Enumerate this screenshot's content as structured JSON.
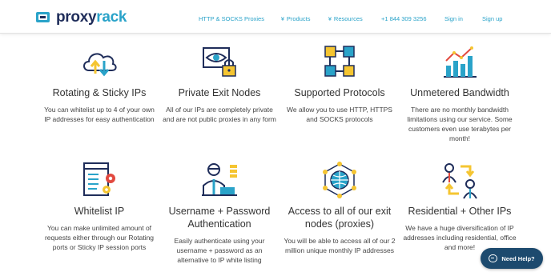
{
  "header": {
    "logo_part1": "proxy",
    "logo_part2": "rack",
    "nav": [
      {
        "label": "HTTP & SOCKS Proxies",
        "dropdown": false
      },
      {
        "label": "Products",
        "dropdown": true
      },
      {
        "label": "Resources",
        "dropdown": true
      },
      {
        "label": "+1 844 309 3256",
        "dropdown": false
      },
      {
        "label": "Sign in",
        "dropdown": false
      },
      {
        "label": "Sign up",
        "dropdown": false
      }
    ],
    "caret_glyph": "¥"
  },
  "features": [
    {
      "icon": "cloud-transfer-icon",
      "title": "Rotating & Sticky IPs",
      "description": "You can whitelist up to 4 of your own IP addresses for easy authentication"
    },
    {
      "icon": "eye-lock-icon",
      "title": "Private Exit Nodes",
      "description": "All of our IPs are completely private and are not public proxies in any form"
    },
    {
      "icon": "protocol-chain-icon",
      "title": "Supported Protocols",
      "description": "We allow you to use HTTP, HTTPS and SOCKS protocols"
    },
    {
      "icon": "bandwidth-chart-icon",
      "title": "Unmetered Bandwidth",
      "description": "There are no monthly bandwidth limitations using our service. Some customers even use terabytes per month!"
    },
    {
      "icon": "whitelist-browser-icon",
      "title": "Whitelist IP",
      "description": "You can make unlimited amount of requests either through our Rotating ports or Sticky IP session ports"
    },
    {
      "icon": "user-laptop-icon",
      "title": "Username + Password Authentication",
      "description": "Easily authenticate using your username + password as an alternative to IP white listing"
    },
    {
      "icon": "globe-network-icon",
      "title": "Access to all of our exit nodes (proxies)",
      "description": "You will be able to access all of our 2 million unique monthly IP addresses"
    },
    {
      "icon": "users-exchange-icon",
      "title": "Residential + Other IPs",
      "description": "We have a huge diversification of IP addresses including residential, office and more!"
    }
  ],
  "help_button": {
    "label": "Need Help?"
  },
  "colors": {
    "accent": "#2aa3c9",
    "navy": "#1f2d5a",
    "yellow": "#f5c531",
    "help_bg": "#1d4a6e"
  }
}
